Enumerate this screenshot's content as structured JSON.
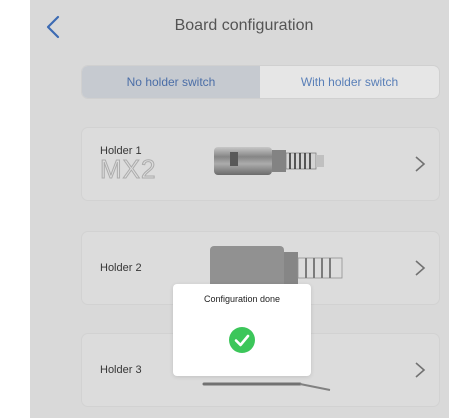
{
  "header": {
    "title": "Board configuration"
  },
  "segmented": {
    "left_label": "No holder switch",
    "right_label": "With holder switch",
    "selected": "No holder switch"
  },
  "holders": [
    {
      "label": "Holder 1",
      "model": "MX2"
    },
    {
      "label": "Holder 2"
    },
    {
      "label": "Holder 3"
    }
  ],
  "dialog": {
    "message": "Configuration done"
  },
  "colors": {
    "accent": "#3b6fc1",
    "success": "#3cc65a",
    "background": "#ececec"
  },
  "icons": {
    "back": "chevron-left-icon",
    "chevron": "chevron-right-icon",
    "success": "check-circle-icon"
  }
}
